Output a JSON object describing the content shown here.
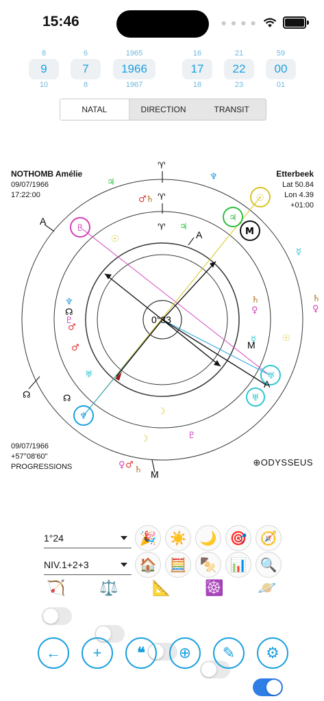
{
  "status": {
    "time": "15:46",
    "signal": "signal-dots",
    "wifi": "wifi-icon",
    "battery": "battery-icon"
  },
  "pickers": [
    {
      "above": "8",
      "value": "9",
      "below": "10"
    },
    {
      "above": "6",
      "value": "7",
      "below": "8"
    },
    {
      "above": "1965",
      "value": "1966",
      "below": "1967"
    },
    {
      "above": "16",
      "value": "17",
      "below": "18"
    },
    {
      "above": "21",
      "value": "22",
      "below": "23"
    },
    {
      "above": "59",
      "value": "00",
      "below": "01"
    }
  ],
  "tabs": [
    "NATAL",
    "DIRECTION",
    "TRANSIT"
  ],
  "active_tab": "NATAL",
  "subject": {
    "name": "NOTHOMB Amélie",
    "date": "09/07/1966",
    "time": "17:22:00"
  },
  "place": {
    "name": "Etterbeek",
    "lat": "Lat 50.84",
    "lon": "Lon 4.39",
    "tz": "+01:00"
  },
  "progression": {
    "date": "09/07/1966",
    "arc": "+57°08'60\"",
    "label": "PROGRESSIONS"
  },
  "chart": {
    "center_label": "0°33",
    "asc_marker": "A",
    "mc_marker": "M"
  },
  "logo": "ODYSSEUS",
  "controls": {
    "orb_select": "1°24",
    "level_select": "NIV.1+2+3",
    "row1_icons": [
      "party-popper-icon",
      "sun-icon",
      "crescent-moon-icon",
      "target-icon",
      "compass-icon"
    ],
    "row2_icons": [
      "house-icon",
      "abacus-icon",
      "oden-icon",
      "bar-chart-icon",
      "magnifier-icon"
    ],
    "row3_icons": [
      "sagittarius-icon",
      "libra-icon",
      "triangle-ruler-icon",
      "wheel-icon",
      "saturn-planet-icon"
    ],
    "toggles": [
      false,
      false,
      false,
      false,
      true
    ]
  },
  "nav": [
    "back-arrow-icon",
    "plus-icon",
    "quote-icon",
    "astro-symbol-icon",
    "feather-icon",
    "gear-icon"
  ],
  "colors": {
    "accent": "#1ba0de",
    "toggle_on": "#2f7ee6"
  }
}
